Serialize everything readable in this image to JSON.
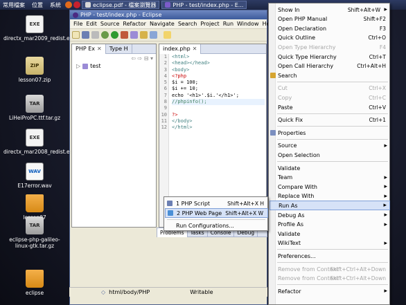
{
  "taskbar": {
    "menu1": "常用檔案",
    "menu2": "位置",
    "menu3": "系統",
    "task1": "eclipse.pdf - 檔案瀏覽器",
    "task2": "PHP - test/index.php - E..."
  },
  "desktop_icons": [
    {
      "label": "directx_mar2009_redist.exe",
      "icon": "setup-icon"
    },
    {
      "label": "lesson07.zip",
      "icon": "zip-icon"
    },
    {
      "label": "LiHeiProPC.ttf.tar.gz",
      "icon": "tar-icon"
    },
    {
      "label": "directx_mar2008_redist.exe",
      "icon": "setup-icon"
    },
    {
      "label": "E17error.wav",
      "icon": "wav-icon"
    },
    {
      "label": "lesson07",
      "icon": "folder-icon"
    },
    {
      "label": "eclipse-php-galileo-linux-gtk.tar.gz",
      "icon": "tar-icon"
    },
    {
      "label": "eclipse",
      "icon": "folder-icon"
    }
  ],
  "window": {
    "title": "PHP - test/index.php - Eclipse",
    "menus": [
      "File",
      "Edit",
      "Source",
      "Refactor",
      "Navigate",
      "Search",
      "Project",
      "Run",
      "Window",
      "Help"
    ]
  },
  "explorer": {
    "tab1": "PHP Ex",
    "tab2": "Type H",
    "tree_item": "test"
  },
  "editor": {
    "tab": "index.php",
    "lines": [
      "<html>",
      "<head></head>",
      "<body>",
      "<?php",
      "$i = 100;",
      "$i += 10;",
      "echo '<h1>'.$i.'</h1>';",
      "//phpinfo();",
      "",
      "?>",
      "</body>",
      "</html>"
    ]
  },
  "bottom_panel": {
    "tabs": [
      "Problems",
      "Tasks",
      "Console",
      "Debug"
    ]
  },
  "statusbar": {
    "path": "html/body/PHP",
    "mode": "Writable"
  },
  "context_menu": {
    "items": [
      {
        "label": "Show In",
        "shortcut": "Shift+Alt+W",
        "submenu": true
      },
      {
        "label": "Open PHP Manual",
        "shortcut": "Shift+F2"
      },
      {
        "label": "Open Declaration",
        "shortcut": "F3"
      },
      {
        "label": "Quick Outline",
        "shortcut": "Ctrl+O"
      },
      {
        "label": "Open Type Hierarchy",
        "shortcut": "F4",
        "disabled": true
      },
      {
        "label": "Quick Type Hierarchy",
        "shortcut": "Ctrl+T"
      },
      {
        "label": "Open Call Hierarchy",
        "shortcut": "Ctrl+Alt+H"
      },
      {
        "label": "Search",
        "icon": true
      },
      {
        "sep": true
      },
      {
        "label": "Cut",
        "shortcut": "Ctrl+X",
        "disabled": true
      },
      {
        "label": "Copy",
        "shortcut": "Ctrl+C",
        "disabled": true
      },
      {
        "label": "Paste",
        "shortcut": "Ctrl+V"
      },
      {
        "sep": true
      },
      {
        "label": "Quick Fix",
        "shortcut": "Ctrl+1"
      },
      {
        "sep": true
      },
      {
        "label": "Properties",
        "icon": true
      },
      {
        "sep": true
      },
      {
        "label": "Source",
        "submenu": true
      },
      {
        "label": "Open Selection"
      },
      {
        "sep": true
      },
      {
        "label": "Validate"
      },
      {
        "label": "Team",
        "submenu": true
      },
      {
        "label": "Compare With",
        "submenu": true
      },
      {
        "label": "Replace With",
        "submenu": true
      },
      {
        "label": "Run As",
        "submenu": true,
        "highlighted": true
      },
      {
        "label": "Debug As",
        "submenu": true
      },
      {
        "label": "Profile As",
        "submenu": true
      },
      {
        "label": "Validate"
      },
      {
        "label": "WikiText",
        "submenu": true
      },
      {
        "sep": true
      },
      {
        "label": "Preferences..."
      },
      {
        "sep": true
      },
      {
        "label": "Remove from Context",
        "shortcut": "Shift+Ctrl+Alt+Down",
        "disabled": true
      },
      {
        "label": "Remove from Context",
        "shortcut": "Shift+Ctrl+Alt+Down",
        "disabled": true
      },
      {
        "sep": true
      },
      {
        "label": "Refactor",
        "submenu": true
      }
    ]
  },
  "run_as_submenu": {
    "items": [
      {
        "label": "1 PHP Script",
        "shortcut": "Shift+Alt+X H"
      },
      {
        "label": "2 PHP Web Page",
        "shortcut": "Shift+Alt+X W",
        "highlighted": true
      },
      {
        "label": "Run Configurations..."
      }
    ]
  },
  "colors": {
    "menu_highlight": "#d6e2f7",
    "php_tag": "#c80000",
    "html_tag": "#3f7f7f",
    "comment": "#3f7f5f"
  }
}
